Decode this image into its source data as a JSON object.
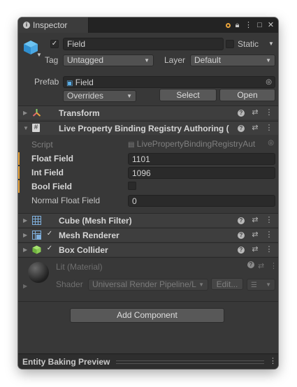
{
  "window": {
    "tab_title": "Inspector",
    "tab_icon": "info-icon",
    "titlebar_icons": [
      "lock-icon",
      "menu-icon",
      "maximize-icon",
      "close-icon"
    ]
  },
  "header": {
    "object_name": "Field",
    "static_label": "Static",
    "tag_label": "Tag",
    "tag_value": "Untagged",
    "layer_label": "Layer",
    "layer_value": "Default",
    "prefab_label": "Prefab",
    "prefab_value": "Field",
    "overrides_label": "Overrides",
    "select_button": "Select",
    "open_button": "Open"
  },
  "components": {
    "transform": "Transform",
    "registry": "Live Property Binding Registry Authoring (",
    "cube": "Cube (Mesh Filter)",
    "mesh_renderer": "Mesh Renderer",
    "box_collider": "Box Collider"
  },
  "registry_props": {
    "script_label": "Script",
    "script_value": "LivePropertyBindingRegistryAut",
    "float_label": "Float Field",
    "float_value": "1101",
    "int_label": "Int Field",
    "int_value": "1096",
    "bool_label": "Bool Field",
    "normal_float_label": "Normal Float Field",
    "normal_float_value": "0"
  },
  "material": {
    "name": "Lit (Material)",
    "shader_label": "Shader",
    "shader_value": "Universal Render Pipeline/L",
    "edit_button": "Edit..."
  },
  "add_component": "Add Component",
  "bottom_title": "Entity Baking Preview",
  "colors": {
    "panel": "#383838",
    "header_row": "#3e3e3e",
    "accent_orange": "#e8a33b",
    "field_bg": "#2a2a2a"
  }
}
